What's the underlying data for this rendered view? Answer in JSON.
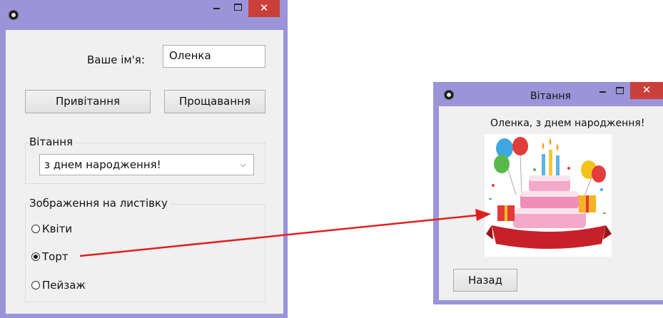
{
  "main_window": {
    "title": "",
    "name_label": "Ваше ім'я:",
    "name_value": "Оленка",
    "greet_button": "Привітання",
    "farewell_button": "Прощавання",
    "greeting_group_title": "Вітання",
    "greeting_selected": "з днем народження!",
    "image_group_title": "Зображення на листівку",
    "image_options": [
      {
        "label": "Квіти",
        "checked": false
      },
      {
        "label": "Торт",
        "checked": true
      },
      {
        "label": "Пейзаж",
        "checked": false
      }
    ]
  },
  "card_window": {
    "title": "Вітання",
    "message": "Оленка, з днем народження!",
    "back_button": "Назад"
  },
  "colors": {
    "window_frame": "#9b94d9",
    "close_button": "#c9403a",
    "client_background": "#f0f0f0",
    "arrow": "#e02020"
  }
}
